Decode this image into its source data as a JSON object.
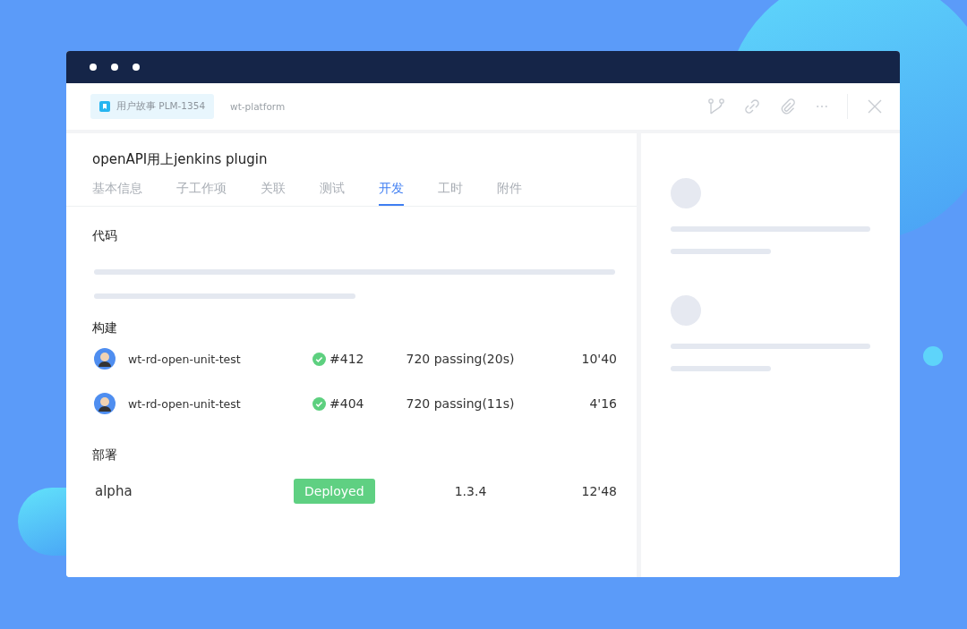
{
  "header": {
    "tag": {
      "label": "用户故事 PLM-1354"
    },
    "project": "wt-platform"
  },
  "title": "openAPI用上jenkins plugin",
  "tabs": [
    {
      "label": "基本信息",
      "selected": false
    },
    {
      "label": "子工作项",
      "selected": false
    },
    {
      "label": "关联",
      "selected": false
    },
    {
      "label": "测试",
      "selected": false
    },
    {
      "label": "开发",
      "selected": true
    },
    {
      "label": "工时",
      "selected": false
    },
    {
      "label": "附件",
      "selected": false
    }
  ],
  "sections": [
    {
      "kind": "code",
      "title": "代码"
    },
    {
      "kind": "builds",
      "title": "构建",
      "rows": [
        {
          "name": "wt-rd-open-unit-test",
          "passed": true,
          "number": "#412",
          "result": "720 passing(20s)",
          "time": "10'40"
        },
        {
          "name": "wt-rd-open-unit-test",
          "passed": true,
          "number": "#404",
          "result": "720 passing(11s)",
          "time": "4'16"
        }
      ]
    },
    {
      "kind": "deploys",
      "title": "部署",
      "rows": [
        {
          "env": "alpha",
          "status": "Deployed",
          "version": "1.3.4",
          "time": "12'48"
        }
      ]
    }
  ]
}
